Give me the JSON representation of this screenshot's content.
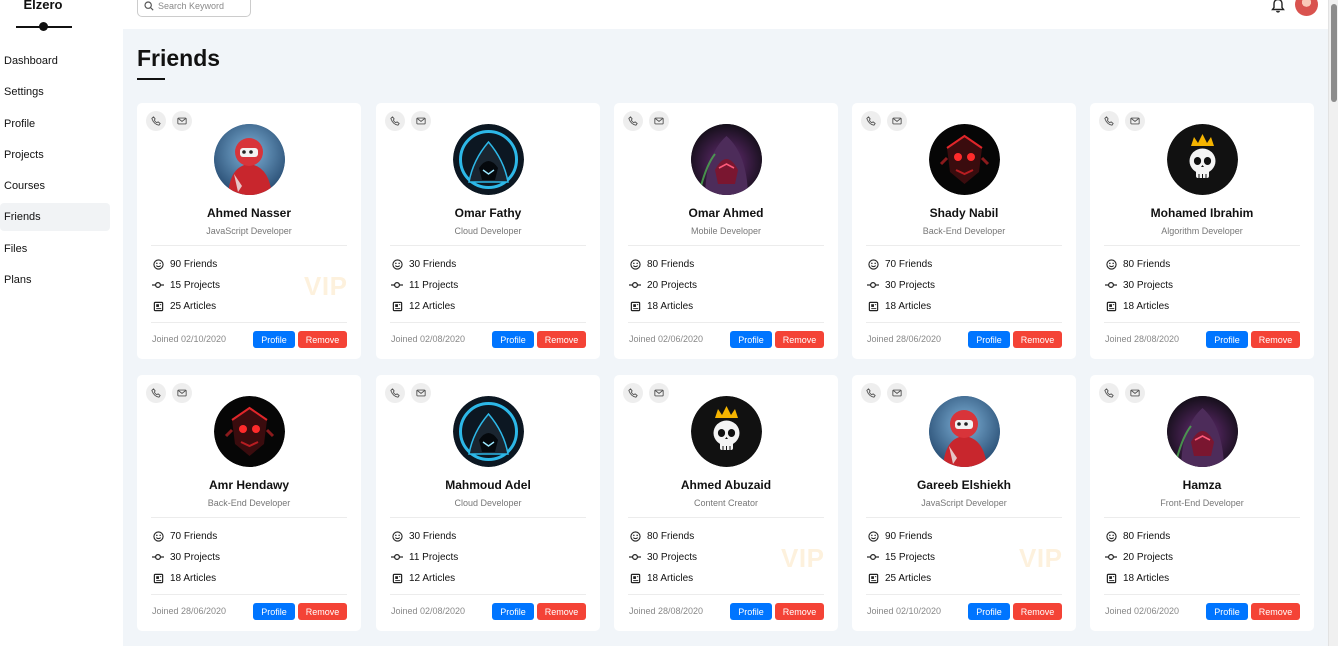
{
  "brand": "Elzero",
  "nav": [
    {
      "label": "Dashboard",
      "key": "dashboard",
      "active": false
    },
    {
      "label": "Settings",
      "key": "settings",
      "active": false
    },
    {
      "label": "Profile",
      "key": "profile",
      "active": false
    },
    {
      "label": "Projects",
      "key": "projects",
      "active": false
    },
    {
      "label": "Courses",
      "key": "courses",
      "active": false
    },
    {
      "label": "Friends",
      "key": "friends",
      "active": true
    },
    {
      "label": "Files",
      "key": "files",
      "active": false
    },
    {
      "label": "Plans",
      "key": "plans",
      "active": false
    }
  ],
  "search": {
    "placeholder": "Search Keyword",
    "value": ""
  },
  "page": {
    "title": "Friends"
  },
  "buttons": {
    "profile": "Profile",
    "remove": "Remove"
  },
  "vip_label": "VIP",
  "friends": [
    {
      "name": "Ahmed Nasser",
      "role": "JavaScript Developer",
      "friends": "90 Friends",
      "projects": "15 Projects",
      "articles": "25 Articles",
      "joined": "Joined 02/10/2020",
      "vip": true,
      "avatar": "fighter-red"
    },
    {
      "name": "Omar Fathy",
      "role": "Cloud Developer",
      "friends": "30 Friends",
      "projects": "11 Projects",
      "articles": "12 Articles",
      "joined": "Joined 02/08/2020",
      "vip": false,
      "avatar": "hooded-blue"
    },
    {
      "name": "Omar Ahmed",
      "role": "Mobile Developer",
      "friends": "80 Friends",
      "projects": "20 Projects",
      "articles": "18 Articles",
      "joined": "Joined 02/06/2020",
      "vip": false,
      "avatar": "hooded-purple"
    },
    {
      "name": "Shady Nabil",
      "role": "Back-End Developer",
      "friends": "70 Friends",
      "projects": "30 Projects",
      "articles": "18 Articles",
      "joined": "Joined 28/06/2020",
      "vip": false,
      "avatar": "robot-red"
    },
    {
      "name": "Mohamed Ibrahim",
      "role": "Algorithm Developer",
      "friends": "80 Friends",
      "projects": "30 Projects",
      "articles": "18 Articles",
      "joined": "Joined 28/08/2020",
      "vip": false,
      "avatar": "skull-crown"
    },
    {
      "name": "Amr Hendawy",
      "role": "Back-End Developer",
      "friends": "70 Friends",
      "projects": "30 Projects",
      "articles": "18 Articles",
      "joined": "Joined 28/06/2020",
      "vip": false,
      "avatar": "robot-red"
    },
    {
      "name": "Mahmoud Adel",
      "role": "Cloud Developer",
      "friends": "30 Friends",
      "projects": "11 Projects",
      "articles": "12 Articles",
      "joined": "Joined 02/08/2020",
      "vip": false,
      "avatar": "hooded-blue"
    },
    {
      "name": "Ahmed Abuzaid",
      "role": "Content Creator",
      "friends": "80 Friends",
      "projects": "30 Projects",
      "articles": "18 Articles",
      "joined": "Joined 28/08/2020",
      "vip": true,
      "avatar": "skull-crown"
    },
    {
      "name": "Gareeb Elshiekh",
      "role": "JavaScript Developer",
      "friends": "90 Friends",
      "projects": "15 Projects",
      "articles": "25 Articles",
      "joined": "Joined 02/10/2020",
      "vip": true,
      "avatar": "fighter-red"
    },
    {
      "name": "Hamza",
      "role": "Front-End Developer",
      "friends": "80 Friends",
      "projects": "20 Projects",
      "articles": "18 Articles",
      "joined": "Joined 02/06/2020",
      "vip": false,
      "avatar": "hooded-purple"
    }
  ],
  "colors": {
    "profile_button": "#0075ff",
    "remove_button": "#f44336",
    "vip": "#f5a623",
    "background": "#f1f5f9"
  }
}
